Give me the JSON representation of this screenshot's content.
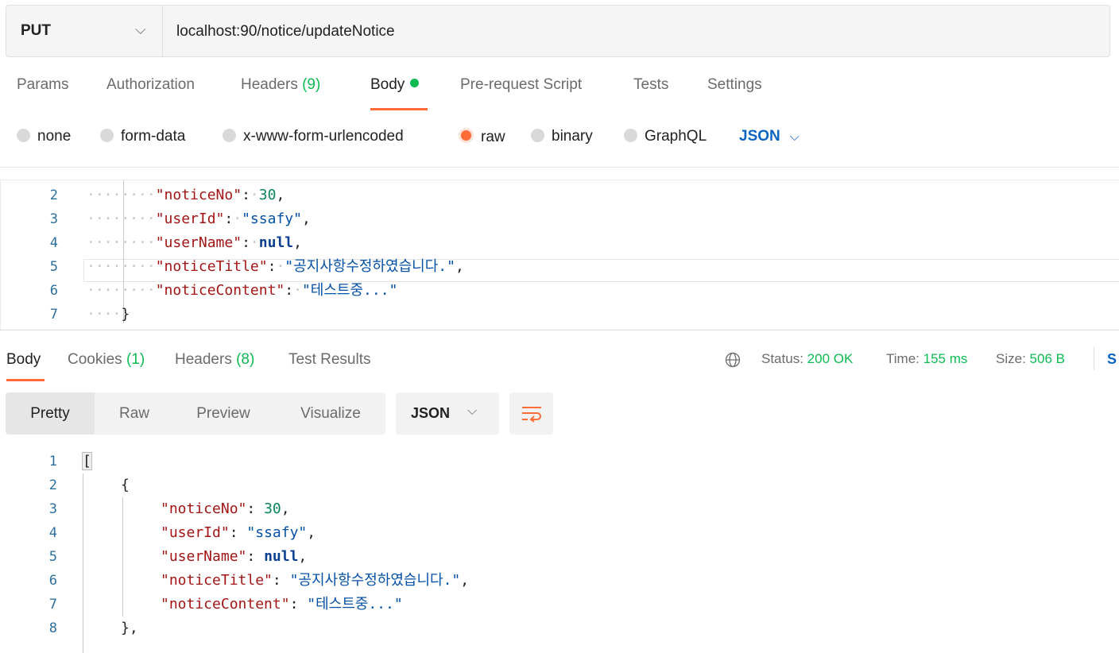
{
  "request": {
    "method": "PUT",
    "url": "localhost:90/notice/updateNotice"
  },
  "request_tabs": {
    "params": "Params",
    "authorization": "Authorization",
    "headers": "Headers",
    "headers_count": "(9)",
    "body": "Body",
    "prerequest": "Pre-request Script",
    "tests": "Tests",
    "settings": "Settings"
  },
  "body_types": {
    "none": "none",
    "form_data": "form-data",
    "urlencoded": "x-www-form-urlencoded",
    "raw": "raw",
    "binary": "binary",
    "graphql": "GraphQL",
    "selected": "raw",
    "format": "JSON"
  },
  "request_body": {
    "lines": [
      {
        "num": "2",
        "key": "\"noticeNo\"",
        "value": "30",
        "value_type": "number",
        "trail": ","
      },
      {
        "num": "3",
        "key": "\"userId\"",
        "value": "\"ssafy\"",
        "value_type": "string",
        "trail": ","
      },
      {
        "num": "4",
        "key": "\"userName\"",
        "value": "null",
        "value_type": "keyword",
        "trail": ","
      },
      {
        "num": "5",
        "key": "\"noticeTitle\"",
        "value": "\"공지사항수정하였습니다.\"",
        "value_type": "string",
        "trail": ","
      },
      {
        "num": "6",
        "key": "\"noticeContent\"",
        "value": "\"테스트중...\"",
        "value_type": "string",
        "trail": ""
      },
      {
        "num": "7",
        "brace": "}"
      }
    ]
  },
  "response_tabs": {
    "body": "Body",
    "cookies": "Cookies",
    "cookies_count": "(1)",
    "headers": "Headers",
    "headers_count": "(8)",
    "test_results": "Test Results"
  },
  "response_meta": {
    "status_label": "Status:",
    "status_value": "200 OK",
    "time_label": "Time:",
    "time_value": "155 ms",
    "size_label": "Size:",
    "size_value": "506 B",
    "save_partial": "S"
  },
  "response_view": {
    "pretty": "Pretty",
    "raw": "Raw",
    "preview": "Preview",
    "visualize": "Visualize",
    "format": "JSON"
  },
  "response_body": {
    "lines": [
      {
        "num": "1",
        "text": "["
      },
      {
        "num": "2",
        "text": "{"
      },
      {
        "num": "3",
        "key": "\"noticeNo\"",
        "value": "30",
        "value_type": "number",
        "trail": ","
      },
      {
        "num": "4",
        "key": "\"userId\"",
        "value": "\"ssafy\"",
        "value_type": "string",
        "trail": ","
      },
      {
        "num": "5",
        "key": "\"userName\"",
        "value": "null",
        "value_type": "keyword",
        "trail": ","
      },
      {
        "num": "6",
        "key": "\"noticeTitle\"",
        "value": "\"공지사항수정하였습니다.\"",
        "value_type": "string",
        "trail": ","
      },
      {
        "num": "7",
        "key": "\"noticeContent\"",
        "value": "\"테스트중...\"",
        "value_type": "string",
        "trail": ""
      },
      {
        "num": "8",
        "text": "},"
      }
    ]
  },
  "colors": {
    "accent": "#ff6c37",
    "success": "#0cbb52",
    "link": "#0b66c3",
    "json_key": "#a31515",
    "json_string": "#0451a5",
    "json_number": "#098658"
  },
  "icons": {
    "method_dropdown": "chevron-down-icon",
    "globe": "globe-icon",
    "wrap": "wrap-lines-icon"
  }
}
